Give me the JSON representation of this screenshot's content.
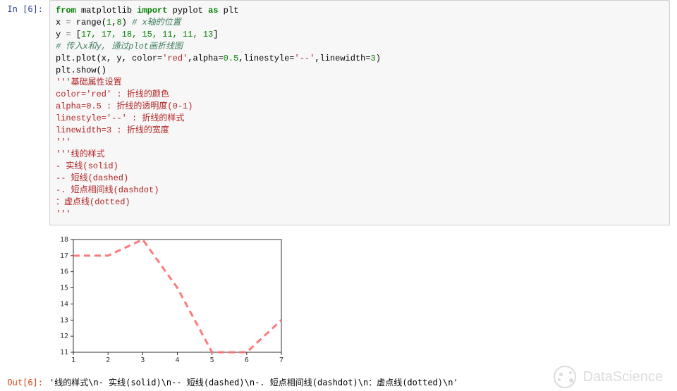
{
  "prompts": {
    "in": "In  [6]:",
    "out": "Out[6]:"
  },
  "code": {
    "l1_from": "from",
    "l1_mod": " matplotlib ",
    "l1_import": "import",
    "l1_as": " pyplot ",
    "l1_as2": "as",
    "l1_alias": " plt",
    "l2_a": "x ",
    "l2_eq": "=",
    "l2_b": " range(",
    "l2_n1": "1",
    "l2_c": ",",
    "l2_n2": "8",
    "l2_d": ") ",
    "l2_cm": "# x轴的位置",
    "l3_a": "y ",
    "l3_eq": "=",
    "l3_b": " [",
    "l3_nums": "17, 17, 18, 15, 11, 11, 13",
    "l3_c": "]",
    "l4_cm": "# 传入x和y, 通过plot画折线图",
    "l5_a": "plt.plot(x, y, color=",
    "l5_s1": "'red'",
    "l5_b": ",alpha=",
    "l5_n1": "0.5",
    "l5_c": ",linestyle=",
    "l5_s2": "'--'",
    "l5_d": ",linewidth=",
    "l5_n2": "3",
    "l5_e": ")",
    "l6": "plt.show()",
    "l7": "'''基础属性设置",
    "l8": "color='red' : 折线的颜色",
    "l9": "alpha=0.5 : 折线的透明度(0-1)",
    "l10": "linestyle='--' : 折线的样式",
    "l11": "linewidth=3 : 折线的宽度",
    "l12": "'''",
    "l13": "'''线的样式",
    "l14": "- 实线(solid)",
    "l15": "-- 短线(dashed)",
    "l16": "-. 短点相间线(dashdot)",
    "l17": "：虚点线(dotted)",
    "l18": "'''"
  },
  "chart_data": {
    "type": "line",
    "x": [
      1,
      2,
      3,
      4,
      5,
      6,
      7
    ],
    "y": [
      17,
      17,
      18,
      15,
      11,
      11,
      13
    ],
    "xlim": [
      1,
      7
    ],
    "ylim": [
      11,
      18
    ],
    "xticks": [
      1,
      2,
      3,
      4,
      5,
      6,
      7
    ],
    "yticks": [
      11,
      12,
      13,
      14,
      15,
      16,
      17,
      18
    ],
    "line_color": "#ff6b6b",
    "line_style": "dashed",
    "line_width": 3,
    "alpha": 0.5
  },
  "output_text": "'线的样式\\n- 实线(solid)\\n-- 短线(dashed)\\n-. 短点相间线(dashdot)\\n：虚点线(dotted)\\n'",
  "watermark": "DataScience"
}
